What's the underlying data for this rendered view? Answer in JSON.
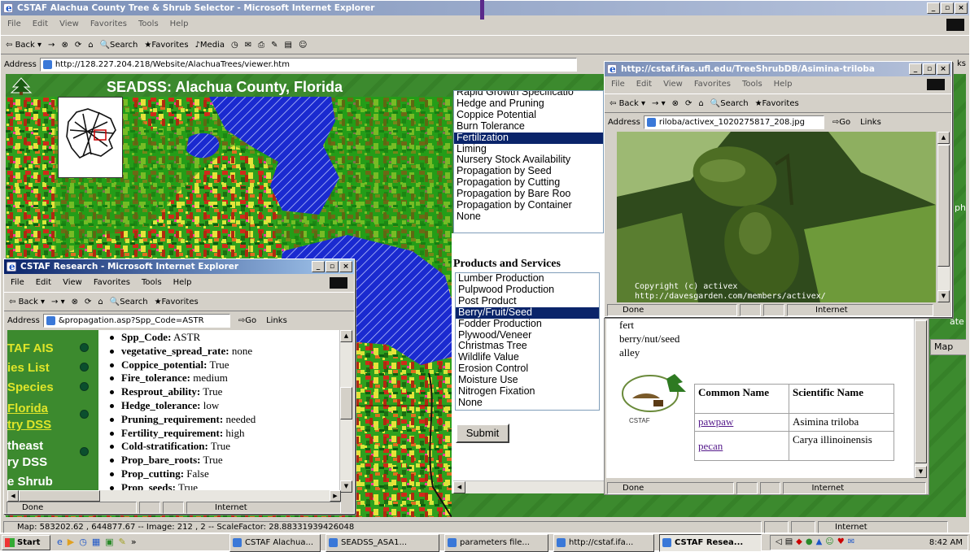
{
  "colors": {
    "title_active": "#0a246a",
    "page_green": "#3c8a2e",
    "highlight": "#0a246a",
    "link_yellow": "#dfe52a",
    "lake_blue": "#1a2ad0"
  },
  "main_window": {
    "title": "CSTAF Alachua County Tree & Shrub Selector - Microsoft Internet Explorer",
    "menu": [
      "File",
      "Edit",
      "View",
      "Favorites",
      "Tools",
      "Help"
    ],
    "toolbar": {
      "back": "Back",
      "forward": "→",
      "search": "Search",
      "favorites": "Favorites",
      "media": "Media"
    },
    "address_label": "Address",
    "address_url": "http://128.227.204.218/Website/AlachuaTrees/viewer.htm",
    "links_partial": "ks",
    "status_text": "Map: 583202.62 , 644877.67 -- Image: 212 , 2 -- ScaleFactor: 28.88331939426048",
    "status_zone": "Internet"
  },
  "map_page": {
    "title": "SEADSS:  Alachua County, Florida",
    "tools": [
      "full-extent-icon",
      "layers-icon",
      "zoom-in-icon",
      "zoom-out-icon",
      "zoom-previous-icon",
      "pan-icon",
      "identify-icon",
      "find-icon"
    ]
  },
  "attributes_list": {
    "items": [
      "Rapid Growth Specificatio",
      "Hedge and Pruning",
      "Coppice Potential",
      "Burn Tolerance",
      "Fertilization",
      "Liming",
      "Nursery Stock Availability",
      "Propagation by Seed",
      "Propagation by Cutting",
      "Propagation by Bare Roo",
      "Propagation by Container",
      "None"
    ],
    "selected_index": 4
  },
  "products": {
    "heading": "Products and Services",
    "items": [
      "Lumber Production",
      "Pulpwood Production",
      "Post Product",
      "Berry/Fruit/Seed",
      "Fodder Production",
      "Plywood/Veneer",
      "Christmas Tree",
      "Wildlife Value",
      "Erosion Control",
      "Moisture Use",
      "Nitrogen Fixation",
      "None"
    ],
    "selected_index": 3,
    "submit": "Submit"
  },
  "results": {
    "query_lines": [
      "fert",
      "berry/nut/seed",
      "alley"
    ],
    "table": {
      "headers": [
        "Common Name",
        "Scientific Name"
      ],
      "rows": [
        {
          "common": "pawpaw",
          "scientific": "Asimina triloba"
        },
        {
          "common": "pecan",
          "scientific": "Carya illinoinensis"
        }
      ]
    },
    "status_done": "Done",
    "status_zone": "Internet"
  },
  "photo_window": {
    "title": "http://cstaf.ifas.ufl.edu/TreeShrubDB/Asimina-triloba",
    "menu": [
      "File",
      "Edit",
      "View",
      "Favorites",
      "Tools",
      "Help"
    ],
    "toolbar": {
      "back": "Back",
      "search": "Search",
      "favorites": "Favorites"
    },
    "address_label": "Address",
    "address_url": "riloba/activex_1020275817_208.jpg",
    "go": "Go",
    "links": "Links",
    "copyright_line1": "Copyright (c) activex",
    "copyright_line2": "http://davesgarden.com/members/activex/",
    "status_done": "Done",
    "status_zone": "Internet"
  },
  "research_window": {
    "title": "CSTAF Research - Microsoft Internet Explorer",
    "menu": [
      "File",
      "Edit",
      "View",
      "Favorites",
      "Tools",
      "Help"
    ],
    "toolbar": {
      "back": "Back",
      "search": "Search",
      "favorites": "Favorites"
    },
    "address_label": "Address",
    "address_url": "&propagation.asp?Spp_Code=ASTR",
    "go": "Go",
    "links": "Links",
    "nav_links": [
      "TAF AIS",
      "ies List",
      "Species",
      "Florida",
      "try DSS",
      "theast",
      "ry DSS",
      "e Shrub"
    ],
    "attributes": [
      {
        "k": "Spp_Code:",
        "v": " ASTR"
      },
      {
        "k": "vegetative_spread_rate:",
        "v": " none"
      },
      {
        "k": "Coppice_potential:",
        "v": " True"
      },
      {
        "k": "Fire_tolerance:",
        "v": " medium"
      },
      {
        "k": "Resprout_ability:",
        "v": " True"
      },
      {
        "k": "Hedge_tolerance:",
        "v": " low"
      },
      {
        "k": "Pruning_requirement:",
        "v": " needed"
      },
      {
        "k": "Fertility_requirement:",
        "v": " high"
      },
      {
        "k": "Cold-stratification:",
        "v": " True"
      },
      {
        "k": "Prop_bare_roots:",
        "v": " True"
      },
      {
        "k": "Prop_cutting:",
        "v": " False"
      },
      {
        "k": "Prop_seeds:",
        "v": " True"
      }
    ],
    "status_done": "Done",
    "status_zone": "Internet"
  },
  "right_edge": {
    "side_texts": [
      "ph",
      "ate",
      "Map"
    ]
  },
  "taskbar": {
    "start": "Start",
    "buttons": [
      "CSTAF Alachua...",
      "SEADSS_ASA1...",
      "parameters file...",
      "http://cstaf.ifa...",
      "CSTAF Resea..."
    ],
    "active_index": 4,
    "clock": "8:42 AM"
  }
}
